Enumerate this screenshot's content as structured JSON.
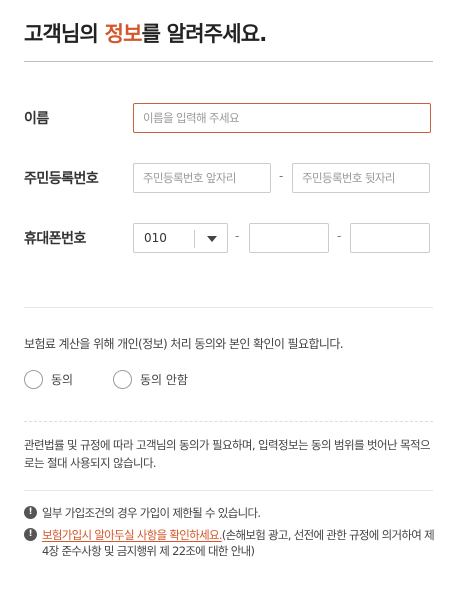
{
  "header": {
    "title_pre": "고객님의 ",
    "title_accent": "정보",
    "title_post": "를 알려주세요."
  },
  "form": {
    "name": {
      "label": "이름",
      "placeholder": "이름을 입력해 주세요"
    },
    "rrn": {
      "label": "주민등록번호",
      "front_placeholder": "주민등록번호 앞자리",
      "back_placeholder": "주민등록번호 뒷자리",
      "separator": "-"
    },
    "phone": {
      "label": "휴대폰번호",
      "carrier_prefix": "010",
      "separator": "-",
      "middle_value": "",
      "last_value": ""
    }
  },
  "consent": {
    "text": "보험료 계산을 위해 개인(정보) 처리 동의와 본인 확인이 필요합니다.",
    "agree_label": "동의",
    "disagree_label": "동의 안함"
  },
  "notice": {
    "text": "관련법률 및 규정에 따라 고객님의 동의가 필요하며, 입력정보는 동의 범위를 벗어난 목적으로는 절대 사용되지 않습니다."
  },
  "warnings": {
    "icon": "exclamation-circle-icon",
    "item1": "일부 가입조건의 경우 가입이 제한될 수 있습니다.",
    "item2_link": "보험가입시 알아두실 사항을 확인하세요.",
    "item2_rest": "(손해보험 광고, 선전에 관한 규정에 의거하여 제4장 준수사항 및 금지행위 제 22조에 대한 안내)"
  },
  "colors": {
    "accent": "#d4562a",
    "input_focus_border": "#c8623e",
    "text": "#333333"
  }
}
